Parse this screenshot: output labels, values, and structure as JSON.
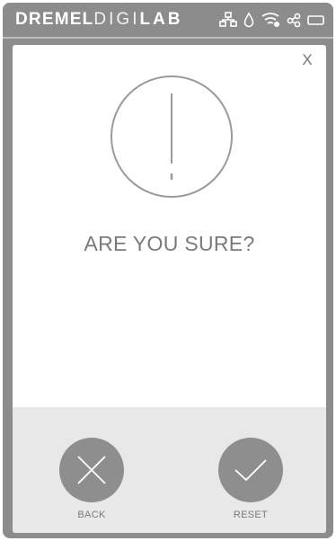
{
  "header": {
    "brand_part1": "DREMEL",
    "brand_part2": "DIGI",
    "brand_part3": "LAB",
    "status_icons": [
      "network-icon",
      "filament-drop-icon",
      "wifi-signal-icon",
      "share-icon",
      "battery-icon"
    ]
  },
  "dialog": {
    "close_label": "X",
    "icon": "exclamation-circle-icon",
    "title": "ARE YOU SURE?",
    "back_label": "BACK",
    "reset_label": "RESET"
  },
  "colors": {
    "frame": "#8c8c8c",
    "dialog_bg": "#ffffff",
    "action_area_bg": "#e8e8e8",
    "action_button": "#8e8e8e",
    "text": "#7a7a7a"
  }
}
